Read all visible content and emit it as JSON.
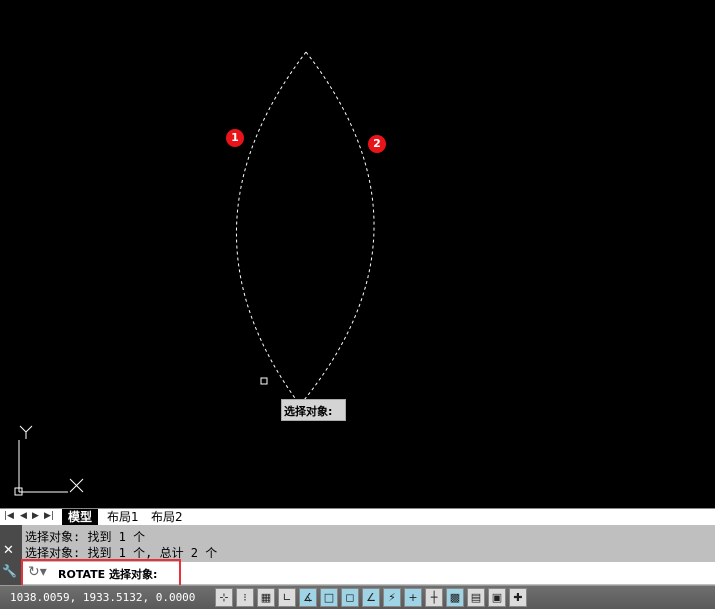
{
  "canvas": {
    "tooltip": "选择对象:",
    "markers": [
      "1",
      "2"
    ],
    "ucs": {
      "x_label": "X",
      "y_label": "Y"
    }
  },
  "tabs": {
    "nav": [
      "|◀",
      "◀",
      "▶",
      "▶|"
    ],
    "items": [
      "模型",
      "布局1",
      "布局2"
    ]
  },
  "command": {
    "history": [
      "选择对象: 找到 1 个",
      "选择对象: 找到 1 个, 总计 2 个"
    ],
    "current": "ROTATE 选择对象:",
    "close_icon": "✕",
    "settings_icon": "🔧"
  },
  "status": {
    "coords": "1038.0059,  1933.5132,  0.0000",
    "buttons": [
      {
        "name": "infer-constraints",
        "glyph": "⊹",
        "on": false
      },
      {
        "name": "snap",
        "glyph": "⁝",
        "on": false
      },
      {
        "name": "grid",
        "glyph": "▦",
        "on": false
      },
      {
        "name": "ortho",
        "glyph": "∟",
        "on": false
      },
      {
        "name": "polar",
        "glyph": "∡",
        "on": true
      },
      {
        "name": "osnap",
        "glyph": "□",
        "on": true
      },
      {
        "name": "3d-osnap",
        "glyph": "◻",
        "on": true
      },
      {
        "name": "otrack",
        "glyph": "∠",
        "on": true
      },
      {
        "name": "ducs",
        "glyph": "⚡",
        "on": true
      },
      {
        "name": "dyn",
        "glyph": "+",
        "on": true
      },
      {
        "name": "lineweight",
        "glyph": "┼",
        "on": false
      },
      {
        "name": "transparency",
        "glyph": "▩",
        "on": true
      },
      {
        "name": "quick-properties",
        "glyph": "▤",
        "on": false
      },
      {
        "name": "selection-cycling",
        "glyph": "▣",
        "on": false
      },
      {
        "name": "annotation-monitor",
        "glyph": "✚",
        "on": false
      }
    ]
  },
  "colors": {
    "accent": "#e8323a",
    "marker": "#e8141a"
  }
}
